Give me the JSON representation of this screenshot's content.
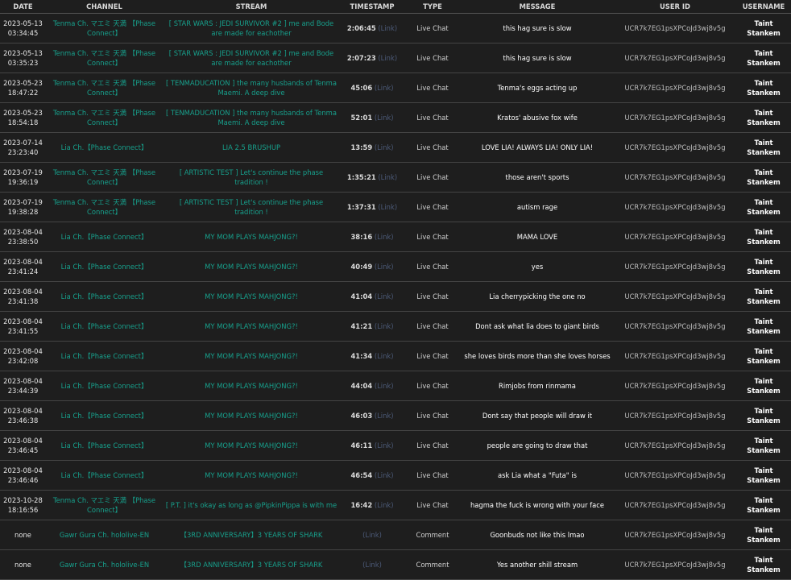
{
  "headers": [
    "DATE",
    "CHANNEL",
    "STREAM",
    "TIMESTAMP",
    "TYPE",
    "MESSAGE",
    "USER ID",
    "USERNAME"
  ],
  "link_label": "(Link)",
  "colors": {
    "background": "#1e1e1e",
    "accent": "#17a08c",
    "link": "#4c5a78"
  },
  "rows": [
    {
      "date": "2023-05-13 03:34:45",
      "channel": "Tenma Ch. マエミ 天満 【Phase Connect】",
      "stream": "[ STAR WARS : JEDI SURVIVOR #2 ] me and Bode are made for eachother",
      "timestamp": "2:06:45",
      "type": "Live Chat",
      "message": "this hag sure is slow",
      "user_id": "UCR7k7EG1psXPCoJd3wj8v5g",
      "username": "Taint Stankem"
    },
    {
      "date": "2023-05-13 03:35:23",
      "channel": "Tenma Ch. マエミ 天満 【Phase Connect】",
      "stream": "[ STAR WARS : JEDI SURVIVOR #2 ] me and Bode are made for eachother",
      "timestamp": "2:07:23",
      "type": "Live Chat",
      "message": "this hag sure is slow",
      "user_id": "UCR7k7EG1psXPCoJd3wj8v5g",
      "username": "Taint Stankem"
    },
    {
      "date": "2023-05-23 18:47:22",
      "channel": "Tenma Ch. マエミ 天満 【Phase Connect】",
      "stream": "[ TENMADUCATION ] the many husbands of Tenma Maemi. A deep dive",
      "timestamp": "45:06",
      "type": "Live Chat",
      "message": "Tenma's eggs acting up",
      "user_id": "UCR7k7EG1psXPCoJd3wj8v5g",
      "username": "Taint Stankem"
    },
    {
      "date": "2023-05-23 18:54:18",
      "channel": "Tenma Ch. マエミ 天満 【Phase Connect】",
      "stream": "[ TENMADUCATION ] the many husbands of Tenma Maemi. A deep dive",
      "timestamp": "52:01",
      "type": "Live Chat",
      "message": "Kratos' abusive fox wife",
      "user_id": "UCR7k7EG1psXPCoJd3wj8v5g",
      "username": "Taint Stankem"
    },
    {
      "date": "2023-07-14 23:23:40",
      "channel": "Lia Ch.【Phase Connect】",
      "stream": "LIA 2.5 BRUSHUP",
      "timestamp": "13:59",
      "type": "Live Chat",
      "message": "LOVE LIA! ALWAYS LIA! ONLY LIA!",
      "user_id": "UCR7k7EG1psXPCoJd3wj8v5g",
      "username": "Taint Stankem"
    },
    {
      "date": "2023-07-19 19:36:19",
      "channel": "Tenma Ch. マエミ 天満 【Phase Connect】",
      "stream": "[ ARTISTIC TEST ] Let's continue the phase tradition !",
      "timestamp": "1:35:21",
      "type": "Live Chat",
      "message": "those aren't sports",
      "user_id": "UCR7k7EG1psXPCoJd3wj8v5g",
      "username": "Taint Stankem"
    },
    {
      "date": "2023-07-19 19:38:28",
      "channel": "Tenma Ch. マエミ 天満 【Phase Connect】",
      "stream": "[ ARTISTIC TEST ] Let's continue the phase tradition !",
      "timestamp": "1:37:31",
      "type": "Live Chat",
      "message": "autism rage",
      "user_id": "UCR7k7EG1psXPCoJd3wj8v5g",
      "username": "Taint Stankem"
    },
    {
      "date": "2023-08-04 23:38:50",
      "channel": "Lia Ch.【Phase Connect】",
      "stream": "MY MOM PLAYS MAHJONG?!",
      "timestamp": "38:16",
      "type": "Live Chat",
      "message": "MAMA LOVE",
      "user_id": "UCR7k7EG1psXPCoJd3wj8v5g",
      "username": "Taint Stankem"
    },
    {
      "date": "2023-08-04 23:41:24",
      "channel": "Lia Ch.【Phase Connect】",
      "stream": "MY MOM PLAYS MAHJONG?!",
      "timestamp": "40:49",
      "type": "Live Chat",
      "message": "yes",
      "user_id": "UCR7k7EG1psXPCoJd3wj8v5g",
      "username": "Taint Stankem"
    },
    {
      "date": "2023-08-04 23:41:38",
      "channel": "Lia Ch.【Phase Connect】",
      "stream": "MY MOM PLAYS MAHJONG?!",
      "timestamp": "41:04",
      "type": "Live Chat",
      "message": "Lia cherrypicking the one no",
      "user_id": "UCR7k7EG1psXPCoJd3wj8v5g",
      "username": "Taint Stankem"
    },
    {
      "date": "2023-08-04 23:41:55",
      "channel": "Lia Ch.【Phase Connect】",
      "stream": "MY MOM PLAYS MAHJONG?!",
      "timestamp": "41:21",
      "type": "Live Chat",
      "message": "Dont ask what lia does to giant birds",
      "user_id": "UCR7k7EG1psXPCoJd3wj8v5g",
      "username": "Taint Stankem"
    },
    {
      "date": "2023-08-04 23:42:08",
      "channel": "Lia Ch.【Phase Connect】",
      "stream": "MY MOM PLAYS MAHJONG?!",
      "timestamp": "41:34",
      "type": "Live Chat",
      "message": "she loves birds more than she loves horses",
      "user_id": "UCR7k7EG1psXPCoJd3wj8v5g",
      "username": "Taint Stankem"
    },
    {
      "date": "2023-08-04 23:44:39",
      "channel": "Lia Ch.【Phase Connect】",
      "stream": "MY MOM PLAYS MAHJONG?!",
      "timestamp": "44:04",
      "type": "Live Chat",
      "message": "Rimjobs from rinmama",
      "user_id": "UCR7k7EG1psXPCoJd3wj8v5g",
      "username": "Taint Stankem"
    },
    {
      "date": "2023-08-04 23:46:38",
      "channel": "Lia Ch.【Phase Connect】",
      "stream": "MY MOM PLAYS MAHJONG?!",
      "timestamp": "46:03",
      "type": "Live Chat",
      "message": "Dont say that people will draw it",
      "user_id": "UCR7k7EG1psXPCoJd3wj8v5g",
      "username": "Taint Stankem"
    },
    {
      "date": "2023-08-04 23:46:45",
      "channel": "Lia Ch.【Phase Connect】",
      "stream": "MY MOM PLAYS MAHJONG?!",
      "timestamp": "46:11",
      "type": "Live Chat",
      "message": "people are going to draw that",
      "user_id": "UCR7k7EG1psXPCoJd3wj8v5g",
      "username": "Taint Stankem"
    },
    {
      "date": "2023-08-04 23:46:46",
      "channel": "Lia Ch.【Phase Connect】",
      "stream": "MY MOM PLAYS MAHJONG?!",
      "timestamp": "46:54",
      "type": "Live Chat",
      "message": "ask Lia what a \"Futa\" is",
      "user_id": "UCR7k7EG1psXPCoJd3wj8v5g",
      "username": "Taint Stankem"
    },
    {
      "date": "2023-10-28 18:16:56",
      "channel": "Tenma Ch. マエミ 天満 【Phase Connect】",
      "stream": "[ P.T. ] it's okay as long as @PipkinPippa is with me",
      "timestamp": "16:42",
      "type": "Live Chat",
      "message": "hagma the fuck is wrong with your face",
      "user_id": "UCR7k7EG1psXPCoJd3wj8v5g",
      "username": "Taint Stankem"
    },
    {
      "date": "none",
      "channel": "Gawr Gura Ch. hololive-EN",
      "stream": "【3RD ANNIVERSARY】3 YEARS OF SHARK",
      "timestamp": "",
      "type": "Comment",
      "message": "Goonbuds not like this lmao",
      "user_id": "UCR7k7EG1psXPCoJd3wj8v5g",
      "username": "Taint Stankem"
    },
    {
      "date": "none",
      "channel": "Gawr Gura Ch. hololive-EN",
      "stream": "【3RD ANNIVERSARY】3 YEARS OF SHARK",
      "timestamp": "",
      "type": "Comment",
      "message": "Yes another shill stream",
      "user_id": "UCR7k7EG1psXPCoJd3wj8v5g",
      "username": "Taint Stankem"
    }
  ]
}
